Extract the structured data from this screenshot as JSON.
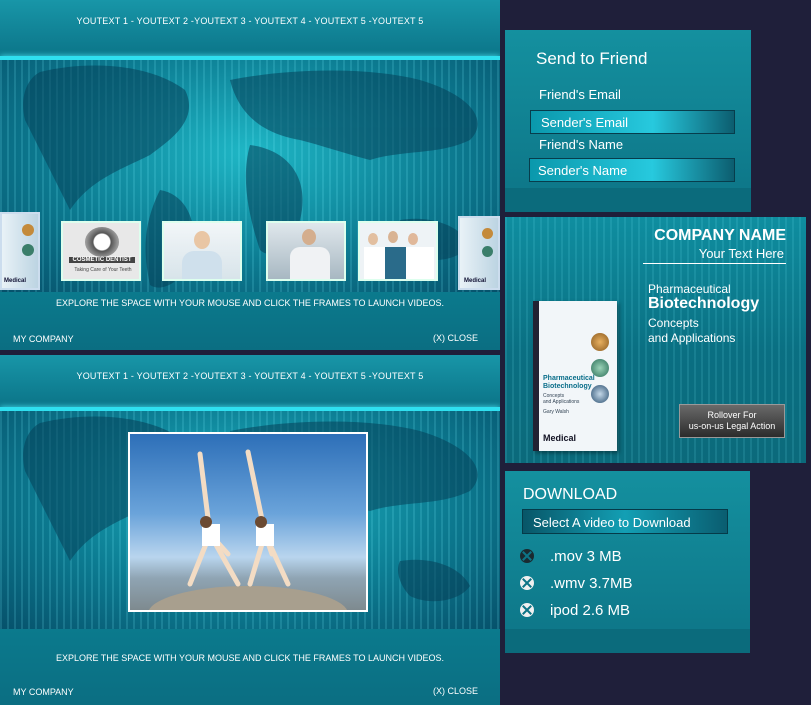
{
  "nav_text": "YOUTEXT 1 - YOUTEXT 2 -YOUTEXT 3 - YOUTEXT 4 - YOUTEXT 5 -YOUTEXT 5",
  "explore_text": "EXPLORE THE SPACE WITH YOUR MOUSE AND CLICK THE FRAMES TO LAUNCH VIDEOS.",
  "my_company": "MY COMPANY",
  "close_label": "(X) CLOSE",
  "thumbs": {
    "dentist_caption": "COSMETIC DENTIST",
    "dentist_sub": "Taking Care of Your Teeth",
    "box_label": "Medical"
  },
  "send_to_friend": {
    "title": "Send to Friend",
    "items": [
      "Friend's Email",
      "Sender's Email",
      "Friend's Name",
      "Sender's Name"
    ]
  },
  "company": {
    "name": "COMPANY NAME",
    "tagline": "Your Text Here",
    "line1": "Pharmaceutical",
    "line2": "Biotechnology",
    "line3": "Concepts",
    "line4": "and Applications",
    "rollover_line1": "Rollover For",
    "rollover_line2": "us-on-us Legal Action",
    "box_title1": "Pharmaceutical",
    "box_title2": "Biotechnology",
    "box_sub1": "Concepts",
    "box_sub2": "and Applications",
    "box_author": "Gary Walsh",
    "box_label": "Medical"
  },
  "download": {
    "title": "DOWNLOAD",
    "select_label": "Select A video to Download",
    "items": [
      ".mov 3 MB",
      ".wmv 3.7MB",
      "ipod 2.6 MB"
    ]
  },
  "colors": {
    "accent": "#2fe0f0",
    "panel": "#0d7486",
    "background": "#1f1f3a"
  }
}
